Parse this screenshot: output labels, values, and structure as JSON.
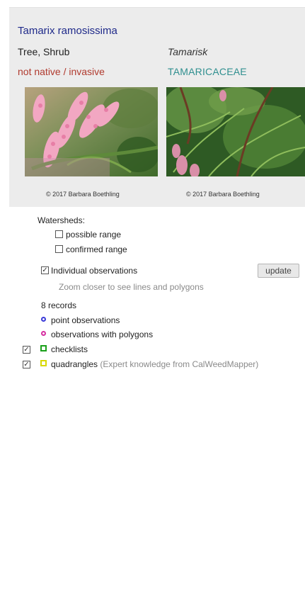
{
  "species": {
    "scientific_name": "Tamarix ramosissima",
    "habit": "Tree, Shrub",
    "common_name": "Tamarisk",
    "status": "not native / invasive",
    "family": "TAMARICACEAE",
    "photos": [
      {
        "credit": "© 2017 Barbara Boethling"
      },
      {
        "credit": "© 2017 Barbara Boethling"
      }
    ]
  },
  "layers": {
    "watersheds_label": "Watersheds:",
    "possible_range_label": "possible range",
    "possible_range_checked": false,
    "confirmed_range_label": "confirmed range",
    "confirmed_range_checked": false,
    "individual_obs_label": "Individual observations",
    "individual_obs_checked": true,
    "update_label": "update",
    "zoom_hint": "Zoom closer to see lines and polygons",
    "records_count": "8 records",
    "point_obs_label": "point observations",
    "polygon_obs_label": "observations with polygons",
    "checklists_label": "checklists",
    "checklists_checked": true,
    "quadrangles_label": "quadrangles",
    "quadrangles_note": "(Expert knowledge from CalWeedMapper)",
    "quadrangles_checked": true
  },
  "colors": {
    "point_obs": "#3a3ad8",
    "polygon_obs": "#d62ea0",
    "checklists": "#1aa01a",
    "quadrangles": "#d8d800",
    "status": "#b03a2e",
    "family": "#2f8f8f",
    "sci_name": "#1f2a8a"
  },
  "icons": {
    "point_obs": "blue-circle-icon",
    "polygon_obs": "magenta-circle-icon",
    "checklists": "green-square-icon",
    "quadrangles": "yellow-square-icon"
  }
}
